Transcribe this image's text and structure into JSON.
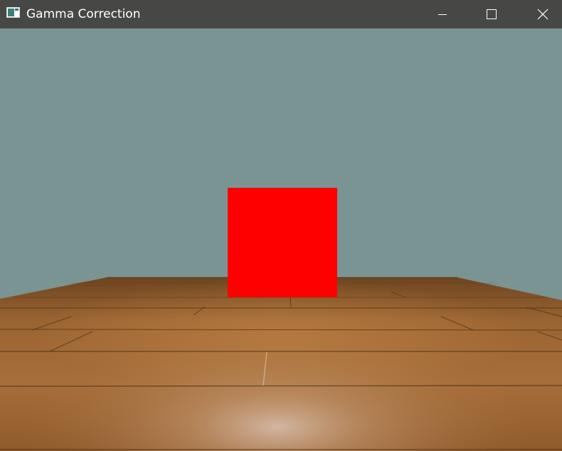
{
  "window": {
    "title": "Gamma Correction",
    "icon": "app-window-icon",
    "controls": {
      "minimize_icon": "minimize-icon",
      "maximize_icon": "maximize-icon",
      "close_icon": "close-icon"
    }
  },
  "scene": {
    "clear_color": "#7a9494",
    "cube_color": "#ff0000",
    "floor_base_color": "#8a5a2b",
    "floor_light_color": "#c9a88c"
  }
}
